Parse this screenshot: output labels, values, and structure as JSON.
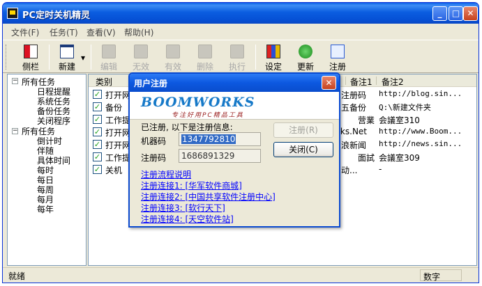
{
  "window": {
    "title": "PC定时关机精灵"
  },
  "menu": [
    "文件(F)",
    "任务(T)",
    "查看(V)",
    "帮助(H)"
  ],
  "toolbar": {
    "sidebar": "侧栏",
    "new": "新建",
    "edit": "编辑",
    "no_effect": "无效",
    "effective": "有效",
    "delete": "删除",
    "execute": "执行",
    "settings": "设定",
    "update": "更新",
    "register": "注册"
  },
  "tree": {
    "all_tasks_1": "所有任务",
    "group1": [
      "日程提醒",
      "系统任务",
      "备份任务",
      "关闭程序"
    ],
    "all_tasks_2": "所有任务",
    "group2": [
      "倒计时",
      "伴随",
      "具体时间",
      "每时",
      "每日",
      "每周",
      "每月",
      "每年"
    ]
  },
  "list": {
    "columns": [
      "类别",
      "备注1",
      "备注2"
    ],
    "rows": [
      {
        "category": "打开网",
        "mid": "注册码",
        "note1": "",
        "note2": "http://blog.sin..."
      },
      {
        "category": "备份",
        "mid": "五备份",
        "note1": "",
        "note2": "Q:\\新建文件夹"
      },
      {
        "category": "工作提",
        "mid": "",
        "note1": "营業",
        "note2": "会議室310"
      },
      {
        "category": "打开网",
        "mid": "rks.Net",
        "note1": "",
        "note2": "http://www.Boom..."
      },
      {
        "category": "打开网",
        "mid": "浪新闻",
        "note1": "",
        "note2": "http://news.sin..."
      },
      {
        "category": "工作提",
        "mid": "",
        "note1": "面試",
        "note2": "会議室309"
      },
      {
        "category": "关机",
        "mid": "动...",
        "note1": "",
        "note2": "-"
      }
    ]
  },
  "status": {
    "left": "就绪",
    "right": "数字"
  },
  "dialog": {
    "title": "用户注册",
    "logo": "BOOMWORKS",
    "logo_sub": "专注好用PC精品工具",
    "registered_msg": "已注册, 以下是注册信息:",
    "machine_label": "机器码",
    "machine_value": "1347792810",
    "code_label": "注册码",
    "code_value": "1686891329",
    "register_button": "注册(R)",
    "close_button": "关闭(C)",
    "links": [
      "注册流程说明",
      "注册连接1: [华军软件商城]",
      "注册连接2: [中国共享软件注册中心]",
      "注册连接3: [软行天下]",
      "注册连接4: [天空软件站]"
    ]
  }
}
